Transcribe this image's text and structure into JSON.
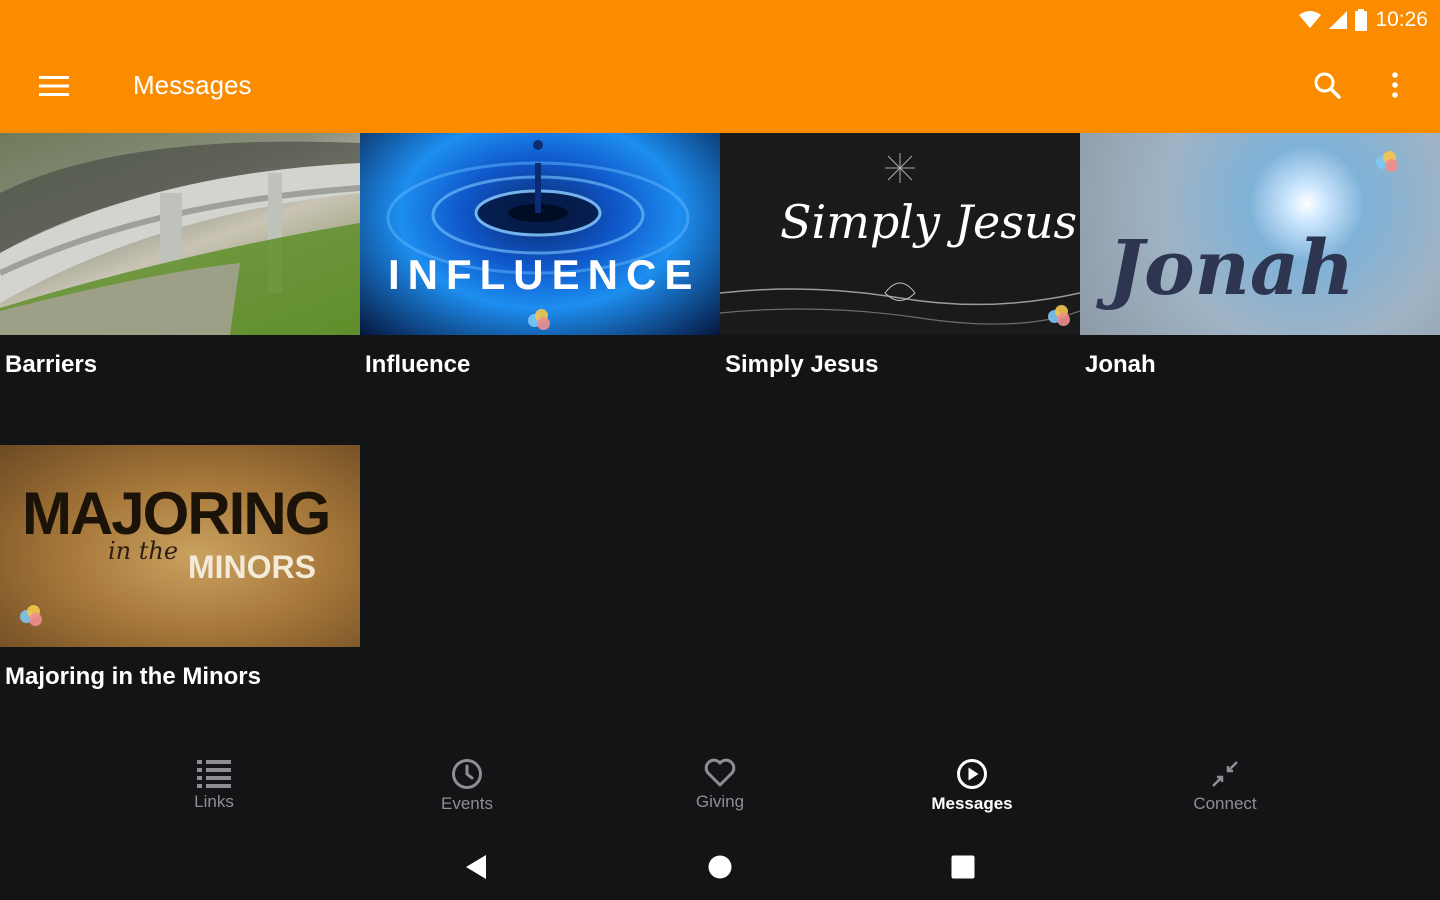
{
  "status_bar": {
    "time": "10:26"
  },
  "app_bar": {
    "title": "Messages"
  },
  "messages": [
    {
      "title": "Barriers"
    },
    {
      "title": "Influence",
      "thumb_text": "INFLUENCE"
    },
    {
      "title": "Simply Jesus",
      "thumb_text": "Simply Jesus"
    },
    {
      "title": "Jonah",
      "thumb_text": "Jonah"
    },
    {
      "title": "Majoring in the Minors",
      "thumb_text_main": "MAJORING",
      "thumb_text_mid": "in the",
      "thumb_text_sub": "MINORS"
    }
  ],
  "bottom_nav": {
    "items": [
      {
        "label": "Links",
        "icon": "list-icon"
      },
      {
        "label": "Events",
        "icon": "clock-icon"
      },
      {
        "label": "Giving",
        "icon": "heart-icon"
      },
      {
        "label": "Messages",
        "icon": "play-circle-icon",
        "active": true
      },
      {
        "label": "Connect",
        "icon": "connect-arrows-icon"
      }
    ]
  },
  "colors": {
    "primary": "#fb8c00",
    "background": "#131416",
    "inactive": "#8d8f93"
  }
}
